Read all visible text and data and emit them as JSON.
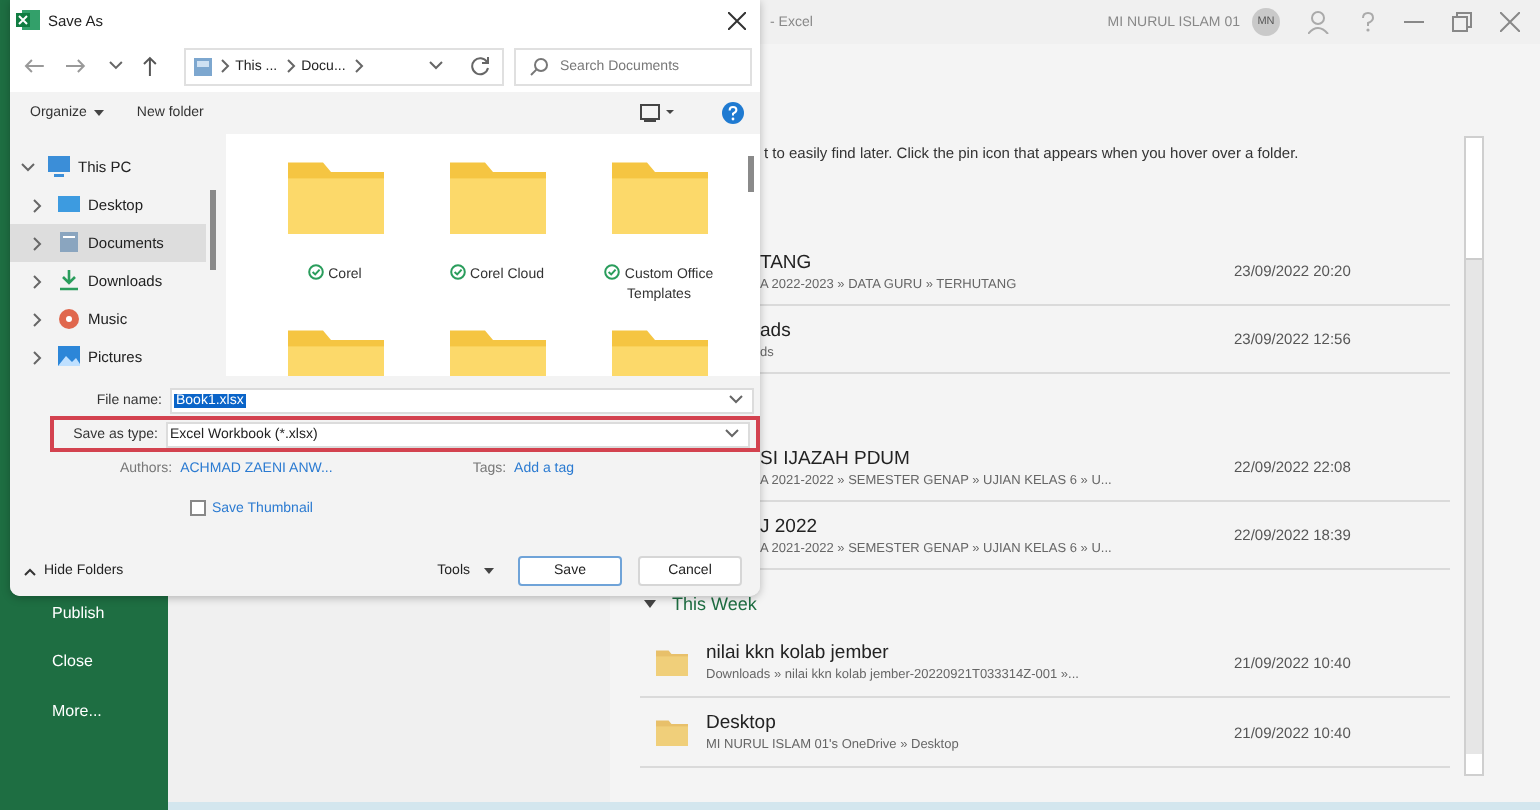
{
  "app_window": {
    "title": "- Excel",
    "account_name": "MI NURUL ISLAM 01",
    "avatar_initials": "MN"
  },
  "sidebar": {
    "items": [
      {
        "label": "Publish"
      },
      {
        "label": "Close"
      },
      {
        "label": "More..."
      }
    ]
  },
  "recent": {
    "hint": "t to easily find later. Click the pin icon that appears when you hover over a folder.",
    "sections": [
      {
        "items": [
          {
            "title": "TANG",
            "path": "A 2022-2023 » DATA GURU » TERHUTANG",
            "date": "23/09/2022 20:20"
          },
          {
            "title": "ads",
            "path": "ds",
            "date": "23/09/2022 12:56"
          }
        ]
      },
      {
        "items": [
          {
            "title": "SI IJAZAH PDUM",
            "path": "A 2021-2022 » SEMESTER GENAP » UJIAN KELAS 6 » U...",
            "date": "22/09/2022 22:08"
          },
          {
            "title": "J 2022",
            "path": "A 2021-2022 » SEMESTER GENAP » UJIAN KELAS 6 » U...",
            "date": "22/09/2022 18:39"
          }
        ]
      }
    ],
    "groups": [
      {
        "title": "This Week",
        "expanded": true,
        "items": [
          {
            "title": "nilai kkn kolab jember",
            "path": "Downloads » nilai kkn kolab jember-20220921T033314Z-001 »...",
            "date": "21/09/2022 10:40"
          },
          {
            "title": "Desktop",
            "path": "MI NURUL ISLAM 01's OneDrive » Desktop",
            "date": "21/09/2022 10:40"
          }
        ]
      }
    ]
  },
  "dialog": {
    "title": "Save As",
    "address": {
      "segments": [
        "This ...",
        "Docu..."
      ]
    },
    "search": {
      "placeholder": "Search Documents"
    },
    "toolbar": {
      "organize": "Organize",
      "new_folder": "New folder"
    },
    "nav_tree": [
      {
        "label": "This PC",
        "expanded": true,
        "selected": false,
        "children": [
          {
            "label": "Desktop",
            "expanded": false,
            "selected": false
          },
          {
            "label": "Documents",
            "expanded": false,
            "selected": true
          },
          {
            "label": "Downloads",
            "expanded": false,
            "selected": false
          },
          {
            "label": "Music",
            "expanded": false,
            "selected": false
          },
          {
            "label": "Pictures",
            "expanded": false,
            "selected": false
          }
        ]
      }
    ],
    "folders": [
      {
        "name": "Corel",
        "synced": true
      },
      {
        "name": "Corel Cloud",
        "synced": true
      },
      {
        "name": "Custom Office Templates",
        "synced": true
      },
      {
        "synced": false
      },
      {
        "synced": false
      },
      {
        "synced": false
      }
    ],
    "file_name": {
      "label": "File name:",
      "value": "Book1.xlsx",
      "selected": true
    },
    "save_as_type": {
      "label": "Save as type:",
      "value": "Excel Workbook (*.xlsx)",
      "highlighted": true
    },
    "authors": {
      "label": "Authors:",
      "value": "ACHMAD ZAENI ANW..."
    },
    "tags": {
      "label": "Tags:",
      "value": "Add a tag"
    },
    "thumbnail": {
      "label": "Save Thumbnail",
      "checked": false
    },
    "hide_folders": "Hide Folders",
    "tools": "Tools",
    "buttons": [
      {
        "label": "Save",
        "kind": "primary"
      },
      {
        "label": "Cancel",
        "kind": "secondary"
      }
    ]
  }
}
